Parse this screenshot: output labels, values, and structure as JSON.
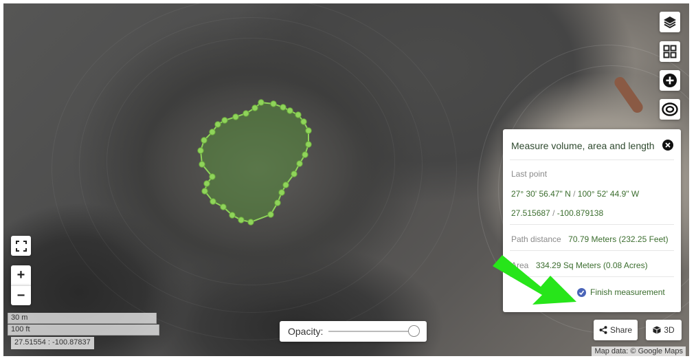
{
  "map": {
    "layers_icon": "layers-icon",
    "grid_icon": "grid-icon",
    "add_icon": "plus-circle-icon",
    "target_icon": "target-icon",
    "fullscreen_icon": "fullscreen-icon",
    "zoom_in_label": "+",
    "zoom_out_label": "−",
    "scale_metric": "30 m",
    "scale_imperial": "100 ft",
    "cursor_coords": "27.51554 : -100.87837",
    "attribution": "Map data: © Google Maps",
    "polygon_color": "#8fd45a"
  },
  "measure_panel": {
    "title": "Measure volume, area and length",
    "last_point_label": "Last point",
    "dms_lat": "27° 30' 56.47\" N",
    "dms_sep": " / ",
    "dms_lon": "100° 52' 44.9\" W",
    "dec_lat": "27.515687",
    "dec_sep": " / ",
    "dec_lon": "-100.879138",
    "path_label": "Path distance",
    "path_value": "70.79 Meters (232.25 Feet)",
    "area_label": "Area",
    "area_value": "334.29 Sq Meters (0.08 Acres)",
    "finish_label": "Finish measurement"
  },
  "opacity": {
    "label": "Opacity:",
    "value": 1.0
  },
  "buttons": {
    "share_label": "Share",
    "threed_label": "3D"
  },
  "annotation": {
    "arrow_color": "#27e51a"
  }
}
